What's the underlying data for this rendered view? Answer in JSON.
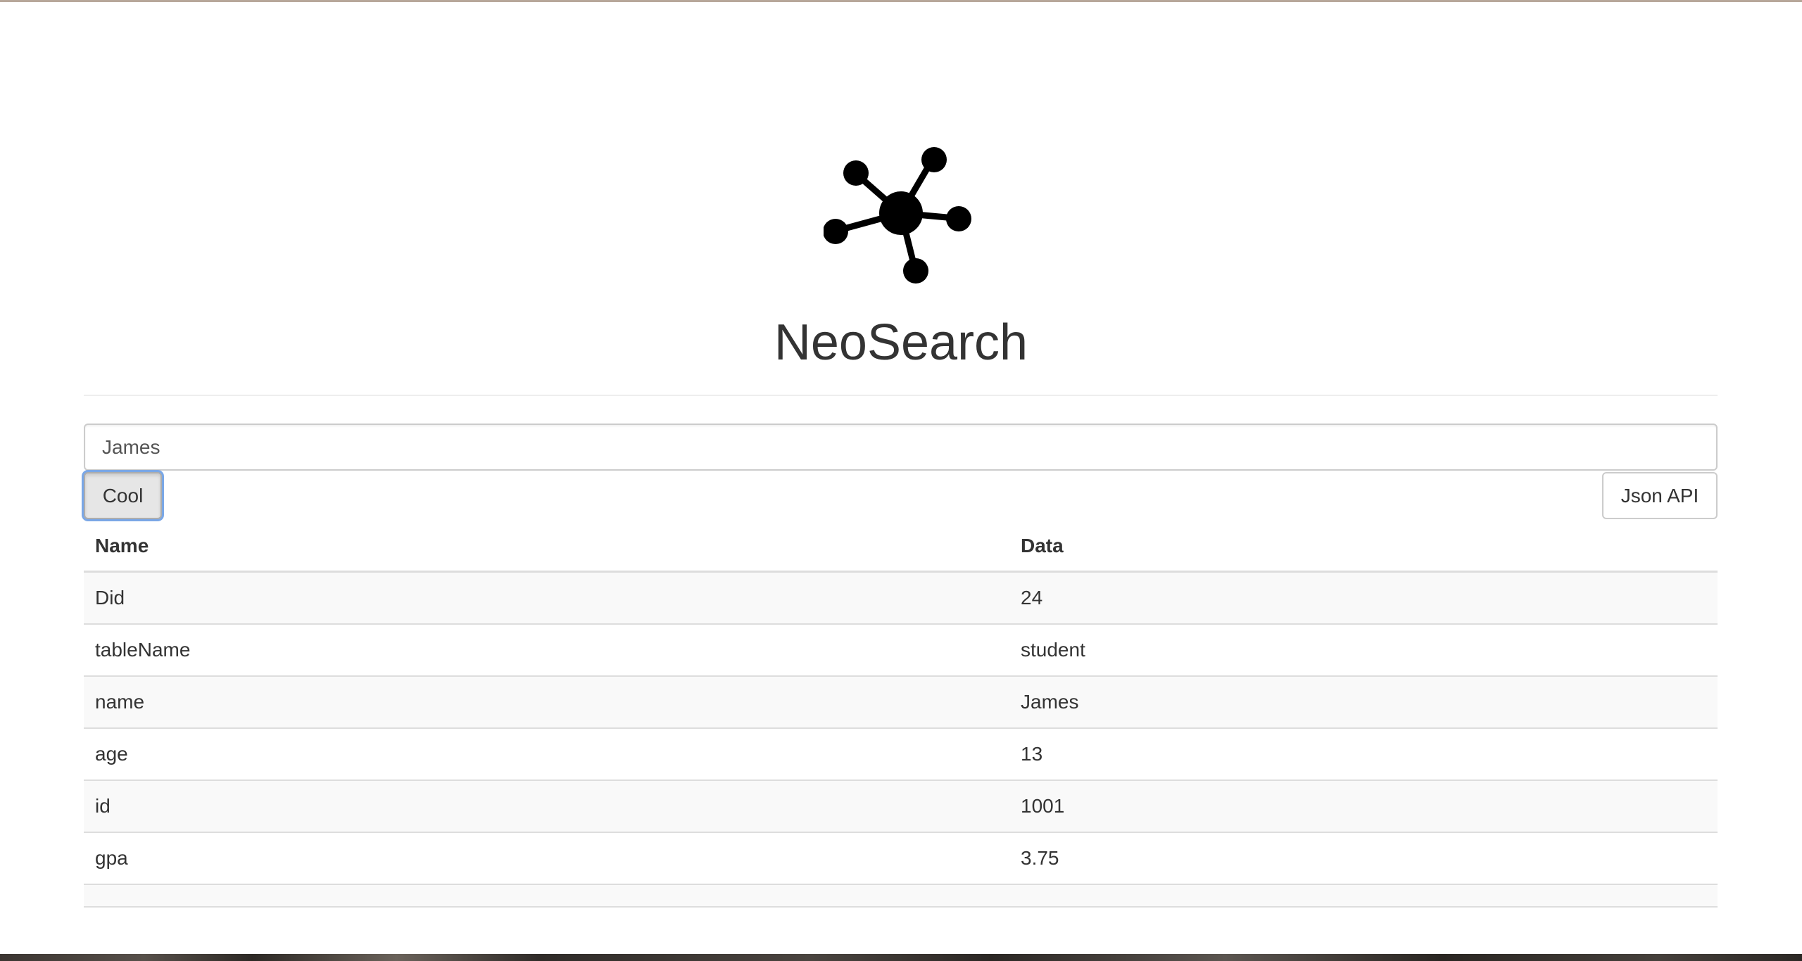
{
  "app": {
    "title": "NeoSearch",
    "logo_icon": "network-hub-icon"
  },
  "search": {
    "value": "James",
    "placeholder": ""
  },
  "buttons": {
    "submit_label": "Cool",
    "json_api_label": "Json API"
  },
  "table": {
    "headers": [
      "Name",
      "Data"
    ],
    "rows": [
      {
        "name": "Did",
        "data": "24"
      },
      {
        "name": "tableName",
        "data": "student"
      },
      {
        "name": "name",
        "data": "James"
      },
      {
        "name": "age",
        "data": "13"
      },
      {
        "name": "id",
        "data": "1001"
      },
      {
        "name": "gpa",
        "data": "3.75"
      }
    ]
  },
  "colors": {
    "text": "#333333",
    "focus_ring": "#7aa7e6",
    "border": "#cccccc",
    "striped_row": "#f9f9f9",
    "row_border": "#dddddd"
  }
}
